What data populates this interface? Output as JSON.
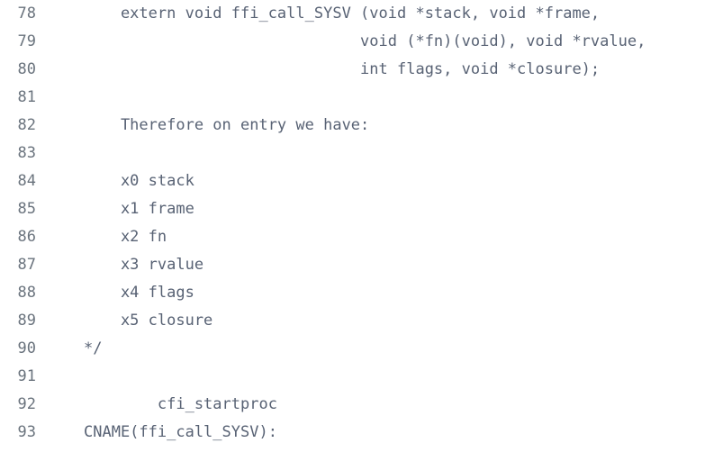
{
  "viewer": {
    "kind": "code-viewer",
    "language": "assembly",
    "background_color": "#ffffff",
    "line_number_color": "#6a737d",
    "code_text_color": "#586274",
    "first_line": 78,
    "last_line": 93
  },
  "lines": [
    {
      "number": "78",
      "text": "    extern void ffi_call_SYSV (void *stack, void *frame,"
    },
    {
      "number": "79",
      "text": "                              void (*fn)(void), void *rvalue,"
    },
    {
      "number": "80",
      "text": "                              int flags, void *closure);"
    },
    {
      "number": "81",
      "text": ""
    },
    {
      "number": "82",
      "text": "    Therefore on entry we have:"
    },
    {
      "number": "83",
      "text": ""
    },
    {
      "number": "84",
      "text": "    x0 stack"
    },
    {
      "number": "85",
      "text": "    x1 frame"
    },
    {
      "number": "86",
      "text": "    x2 fn"
    },
    {
      "number": "87",
      "text": "    x3 rvalue"
    },
    {
      "number": "88",
      "text": "    x4 flags"
    },
    {
      "number": "89",
      "text": "    x5 closure"
    },
    {
      "number": "90",
      "text": "*/"
    },
    {
      "number": "91",
      "text": ""
    },
    {
      "number": "92",
      "text": "        cfi_startproc"
    },
    {
      "number": "93",
      "text": "CNAME(ffi_call_SYSV):"
    }
  ]
}
